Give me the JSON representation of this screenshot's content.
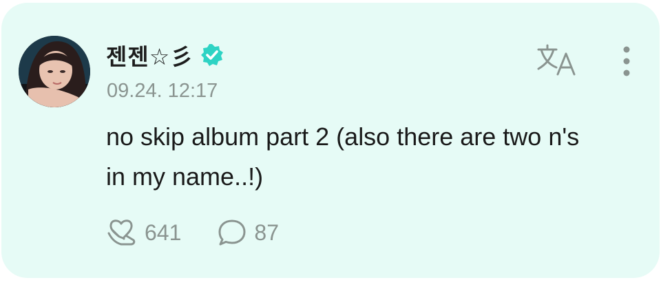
{
  "post": {
    "author_name": "젠젠☆彡",
    "timestamp": "09.24. 12:17",
    "text": "no skip album part 2 (also there are two n's in my name..!)",
    "likes": "641",
    "comments": "87"
  },
  "icons": {
    "verified": "verified-badge-icon",
    "translate": "translate-icon",
    "more": "more-vertical-icon",
    "like": "heart-hug-icon",
    "comment": "comment-bubble-icon"
  },
  "colors": {
    "card_background": "#e6fbf6",
    "verified": "#2ed3c4",
    "muted": "#8a9490",
    "text": "#1a1a1a"
  }
}
